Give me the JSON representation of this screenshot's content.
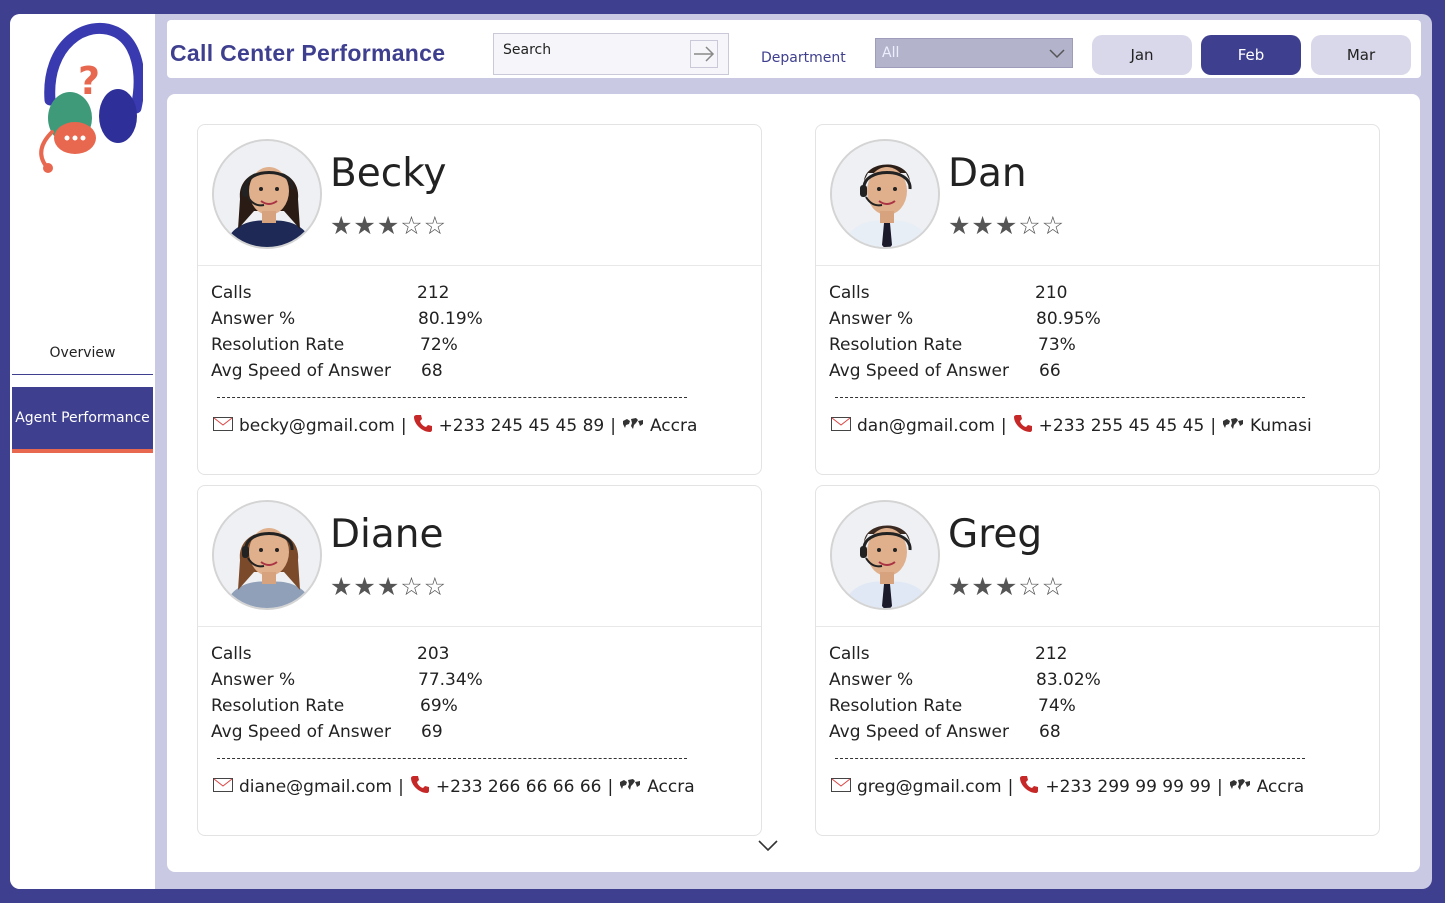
{
  "header": {
    "title": "Call Center Performance",
    "search_label": "Search",
    "department_label": "Department",
    "department_value": "All",
    "months": [
      "Jan",
      "Feb",
      "Mar"
    ],
    "active_month": "Feb"
  },
  "sidebar": {
    "items": [
      {
        "label": "Overview",
        "active": false
      },
      {
        "label": "Agent Performance",
        "active": true
      }
    ]
  },
  "stats_labels": [
    "Calls",
    "Answer %",
    "Resolution Rate",
    "Avg Speed of Answer"
  ],
  "agents": [
    {
      "name": "Becky",
      "rating": 3,
      "calls": "212",
      "answer_pct": "80.19%",
      "resolution_rate": "72%",
      "avg_speed": "68",
      "email": "becky@gmail.com",
      "phone": "+233 245 45 45 89",
      "city": "Accra",
      "gender": "female",
      "hair": "#2a1b14",
      "shirt": "#1e2a55"
    },
    {
      "name": "Dan",
      "rating": 3,
      "calls": "210",
      "answer_pct": "80.95%",
      "resolution_rate": "73%",
      "avg_speed": "66",
      "email": "dan@gmail.com",
      "phone": "+233 255 45 45 45",
      "city": "Kumasi",
      "gender": "male",
      "hair": "#2b1f18",
      "shirt": "#e8eef6"
    },
    {
      "name": "Diane",
      "rating": 3,
      "calls": "203",
      "answer_pct": "77.34%",
      "resolution_rate": "69%",
      "avg_speed": "69",
      "email": "diane@gmail.com",
      "phone": "+233 266 66 66 66",
      "city": "Accra",
      "gender": "female",
      "hair": "#7a4a2a",
      "shirt": "#8fa0b8"
    },
    {
      "name": "Greg",
      "rating": 3,
      "calls": "212",
      "answer_pct": "83.02%",
      "resolution_rate": "74%",
      "avg_speed": "68",
      "email": "greg@gmail.com",
      "phone": "+233 299 99 99 99",
      "city": "Accra",
      "gender": "male",
      "hair": "#3a2a22",
      "shirt": "#dfe8f4"
    }
  ],
  "colors": {
    "accent": "#3f3f8f",
    "panel": "#c9c9e4",
    "orange": "#e8674f"
  }
}
